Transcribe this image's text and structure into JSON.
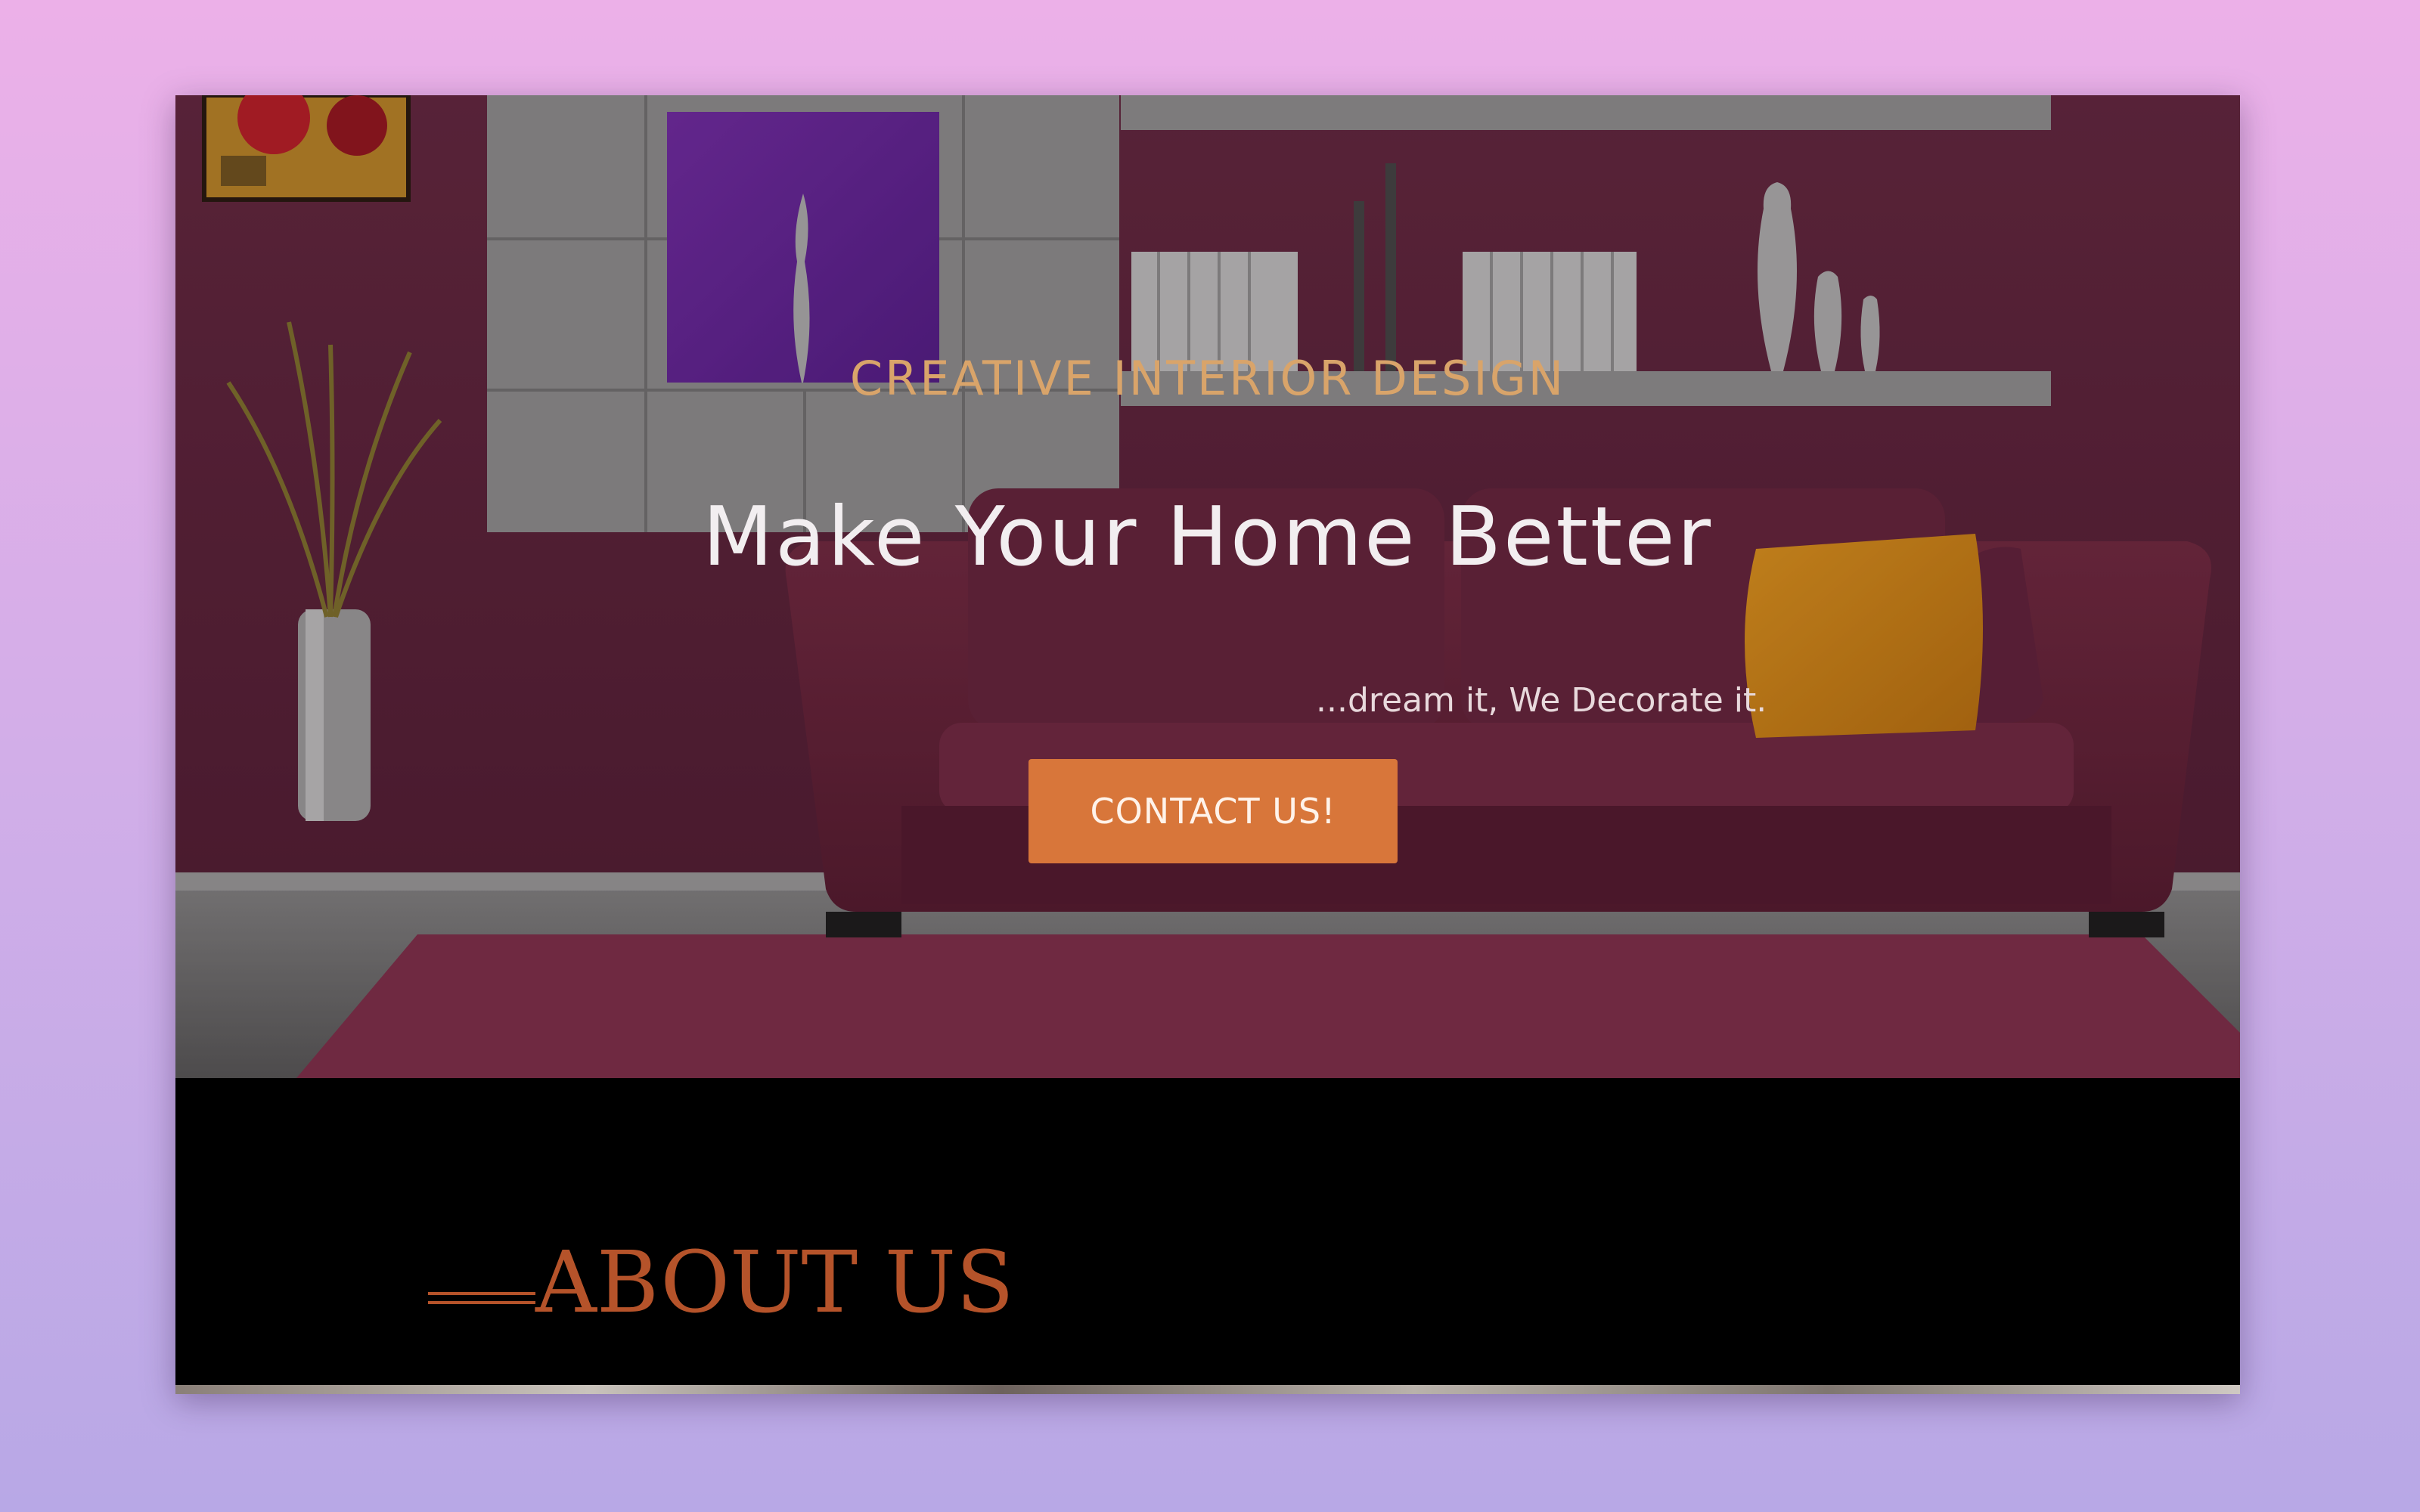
{
  "hero": {
    "kicker": "CREATIVE INTERIOR DESIGN",
    "title": "Make Your Home Better",
    "tagline": "...dream it, We Decorate it.",
    "contact_label": "CONTACT US!"
  },
  "about": {
    "title": "ABOUT US"
  },
  "colors": {
    "accent": "#d8763a",
    "kicker": "#d9a46a",
    "about_title": "#b5532a",
    "page_gradient_top": "#ecb0e8",
    "page_gradient_bottom": "#b8a8e6"
  },
  "icons": {
    "about_rule": "double-line-divider"
  }
}
